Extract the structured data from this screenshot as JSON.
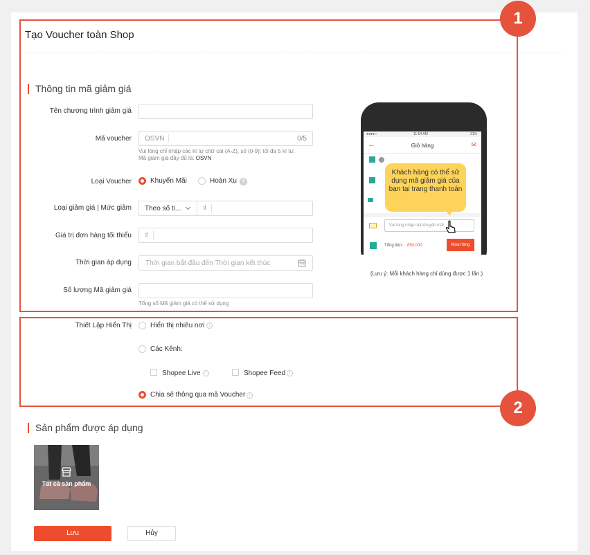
{
  "page": {
    "title": "Tạo Voucher toàn Shop"
  },
  "annotations": {
    "badge1": "1",
    "badge2": "2"
  },
  "info_section": {
    "title": "Thông tin mã giảm giá",
    "program_name": {
      "label": "Tên chương trình giảm giá",
      "value": ""
    },
    "voucher_code": {
      "label": "Mã voucher",
      "prefix": "OSVN",
      "counter": "0/5",
      "hint_line1": "Vui lòng chỉ nhập các kí tự chữ cái (A-Z), số (0-9); tối đa 5 kí tự.",
      "hint_line2_label": "Mã giảm giá đầy đủ là:",
      "hint_line2_value": "OSVN"
    },
    "voucher_type": {
      "label": "Loại Voucher",
      "option1": "Khuyến Mãi",
      "option2": "Hoàn Xu",
      "help_icon": "?"
    },
    "discount": {
      "label": "Loại giảm giá | Mức giảm",
      "select_value": "Theo số ti...",
      "currency": "₫"
    },
    "min_order": {
      "label": "Giá trị đơn hàng tối thiểu",
      "currency": "₫"
    },
    "time": {
      "label": "Thời gian áp dụng",
      "placeholder": "Thời gian bắt đầu đến Thời gian kết thúc"
    },
    "quantity": {
      "label": "Số lượng Mã giảm giá",
      "hint": "Tổng số Mã giảm giá có thể sử dụng"
    }
  },
  "preview": {
    "tooltip": "Khách hàng có thể sử dụng mã giảm giá của bạn tại trang thanh toán",
    "note": "(Lưu ý: Mỗi khách hàng chỉ dùng được 1 lần.)",
    "phone": {
      "status_time": "11:54 AM",
      "status_battery": "31%",
      "header": "Giỏ hàng",
      "voucher_input": "Vui lòng nhập mã khuyến mãi",
      "total_label": "Tổng tiền:",
      "total_value": "đ50.000",
      "buy_button": "Mua hàng"
    }
  },
  "display_section": {
    "label": "Thiết Lập Hiển Thị",
    "option_many": "Hiển thị nhiều nơi",
    "option_channels": "Các Kênh:",
    "channel_live": "Shopee Live",
    "channel_feed": "Shopee Feed",
    "option_share": "Chia sẻ thông qua mã Voucher"
  },
  "products_section": {
    "title": "Sản phẩm được áp dụng",
    "all_products": "Tất cả sản phẩm"
  },
  "actions": {
    "save": "Lưu",
    "cancel": "Hủy"
  },
  "colors": {
    "accent": "#ee4d2d",
    "annotation": "#e5533d",
    "tooltip": "#fdd35a"
  }
}
